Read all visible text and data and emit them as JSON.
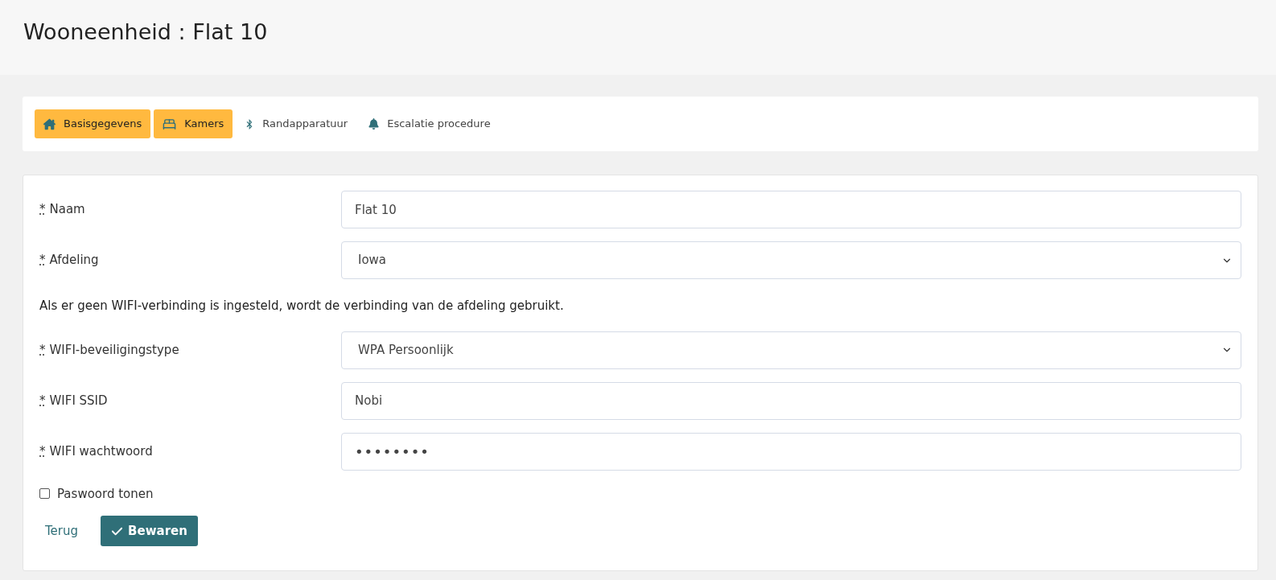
{
  "page_title": "Wooneenheid : Flat 10",
  "tabs": [
    {
      "label": "Basisgegevens",
      "kind": "house",
      "highlighted": true
    },
    {
      "label": "Kamers",
      "kind": "bed",
      "highlighted": true
    },
    {
      "label": "Randapparatuur",
      "kind": "bluetooth",
      "highlighted": false
    },
    {
      "label": "Escalatie procedure",
      "kind": "bell",
      "highlighted": false
    }
  ],
  "form": {
    "fields_top": [
      {
        "kind": "text",
        "required_mark": "*",
        "label": "Naam",
        "value": "Flat 10"
      },
      {
        "kind": "select",
        "required_mark": "*",
        "label": "Afdeling",
        "value": "Iowa"
      }
    ],
    "note": "Als er geen WIFI-verbinding is ingesteld, wordt de verbinding van de afdeling gebruikt.",
    "fields_wifi": [
      {
        "kind": "select",
        "required_mark": "*",
        "label": "WIFI-beveiligingstype",
        "value": "WPA Persoonlijk"
      },
      {
        "kind": "text",
        "required_mark": "*",
        "label": "WIFI SSID",
        "value": "Nobi"
      },
      {
        "kind": "password",
        "required_mark": "*",
        "label": "WIFI wachtwoord",
        "value": "••••••••"
      }
    ],
    "show_password": {
      "label": "Paswoord tonen",
      "checked": false
    },
    "back_link": "Terug",
    "save_button": "Bewaren"
  }
}
